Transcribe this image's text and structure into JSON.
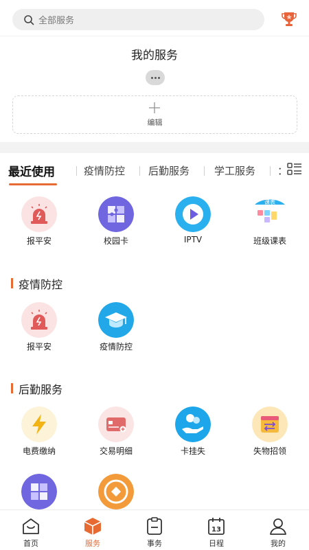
{
  "search": {
    "placeholder": "全部服务"
  },
  "my_services": {
    "title": "我的服务",
    "edit_label": "编辑"
  },
  "tabs": [
    {
      "label": "最近使用",
      "active": true
    },
    {
      "label": "疫情防控"
    },
    {
      "label": "后勤服务"
    },
    {
      "label": "学工服务"
    },
    {
      "label": "："
    }
  ],
  "recent": [
    {
      "label": "报平安",
      "icon": "alarm-icon"
    },
    {
      "label": "校园卡",
      "icon": "puzzle-icon"
    },
    {
      "label": "IPTV",
      "icon": "play-icon"
    },
    {
      "label": "班级课表",
      "icon": "schedule-icon",
      "badge": "课表"
    }
  ],
  "sections": [
    {
      "title": "疫情防控",
      "apps": [
        {
          "label": "报平安",
          "icon": "alarm-icon"
        },
        {
          "label": "疫情防控",
          "icon": "graduation-cap-icon"
        }
      ]
    },
    {
      "title": "后勤服务",
      "apps": [
        {
          "label": "电费缴纳",
          "icon": "lightning-icon"
        },
        {
          "label": "交易明细",
          "icon": "card-icon"
        },
        {
          "label": "卡挂失",
          "icon": "coin-hand-icon"
        },
        {
          "label": "失物招领",
          "icon": "calendar-swap-icon"
        }
      ]
    }
  ],
  "bottom_nav": [
    {
      "label": "首页",
      "icon": "home-icon"
    },
    {
      "label": "服务",
      "icon": "cube-icon",
      "active": true
    },
    {
      "label": "事务",
      "icon": "clipboard-icon"
    },
    {
      "label": "日程",
      "icon": "calendar-icon",
      "date": "13"
    },
    {
      "label": "我的",
      "icon": "user-icon"
    }
  ],
  "colors": {
    "accent": "#e86a33",
    "background": "#ffffff",
    "band": "#f3f3f3"
  }
}
